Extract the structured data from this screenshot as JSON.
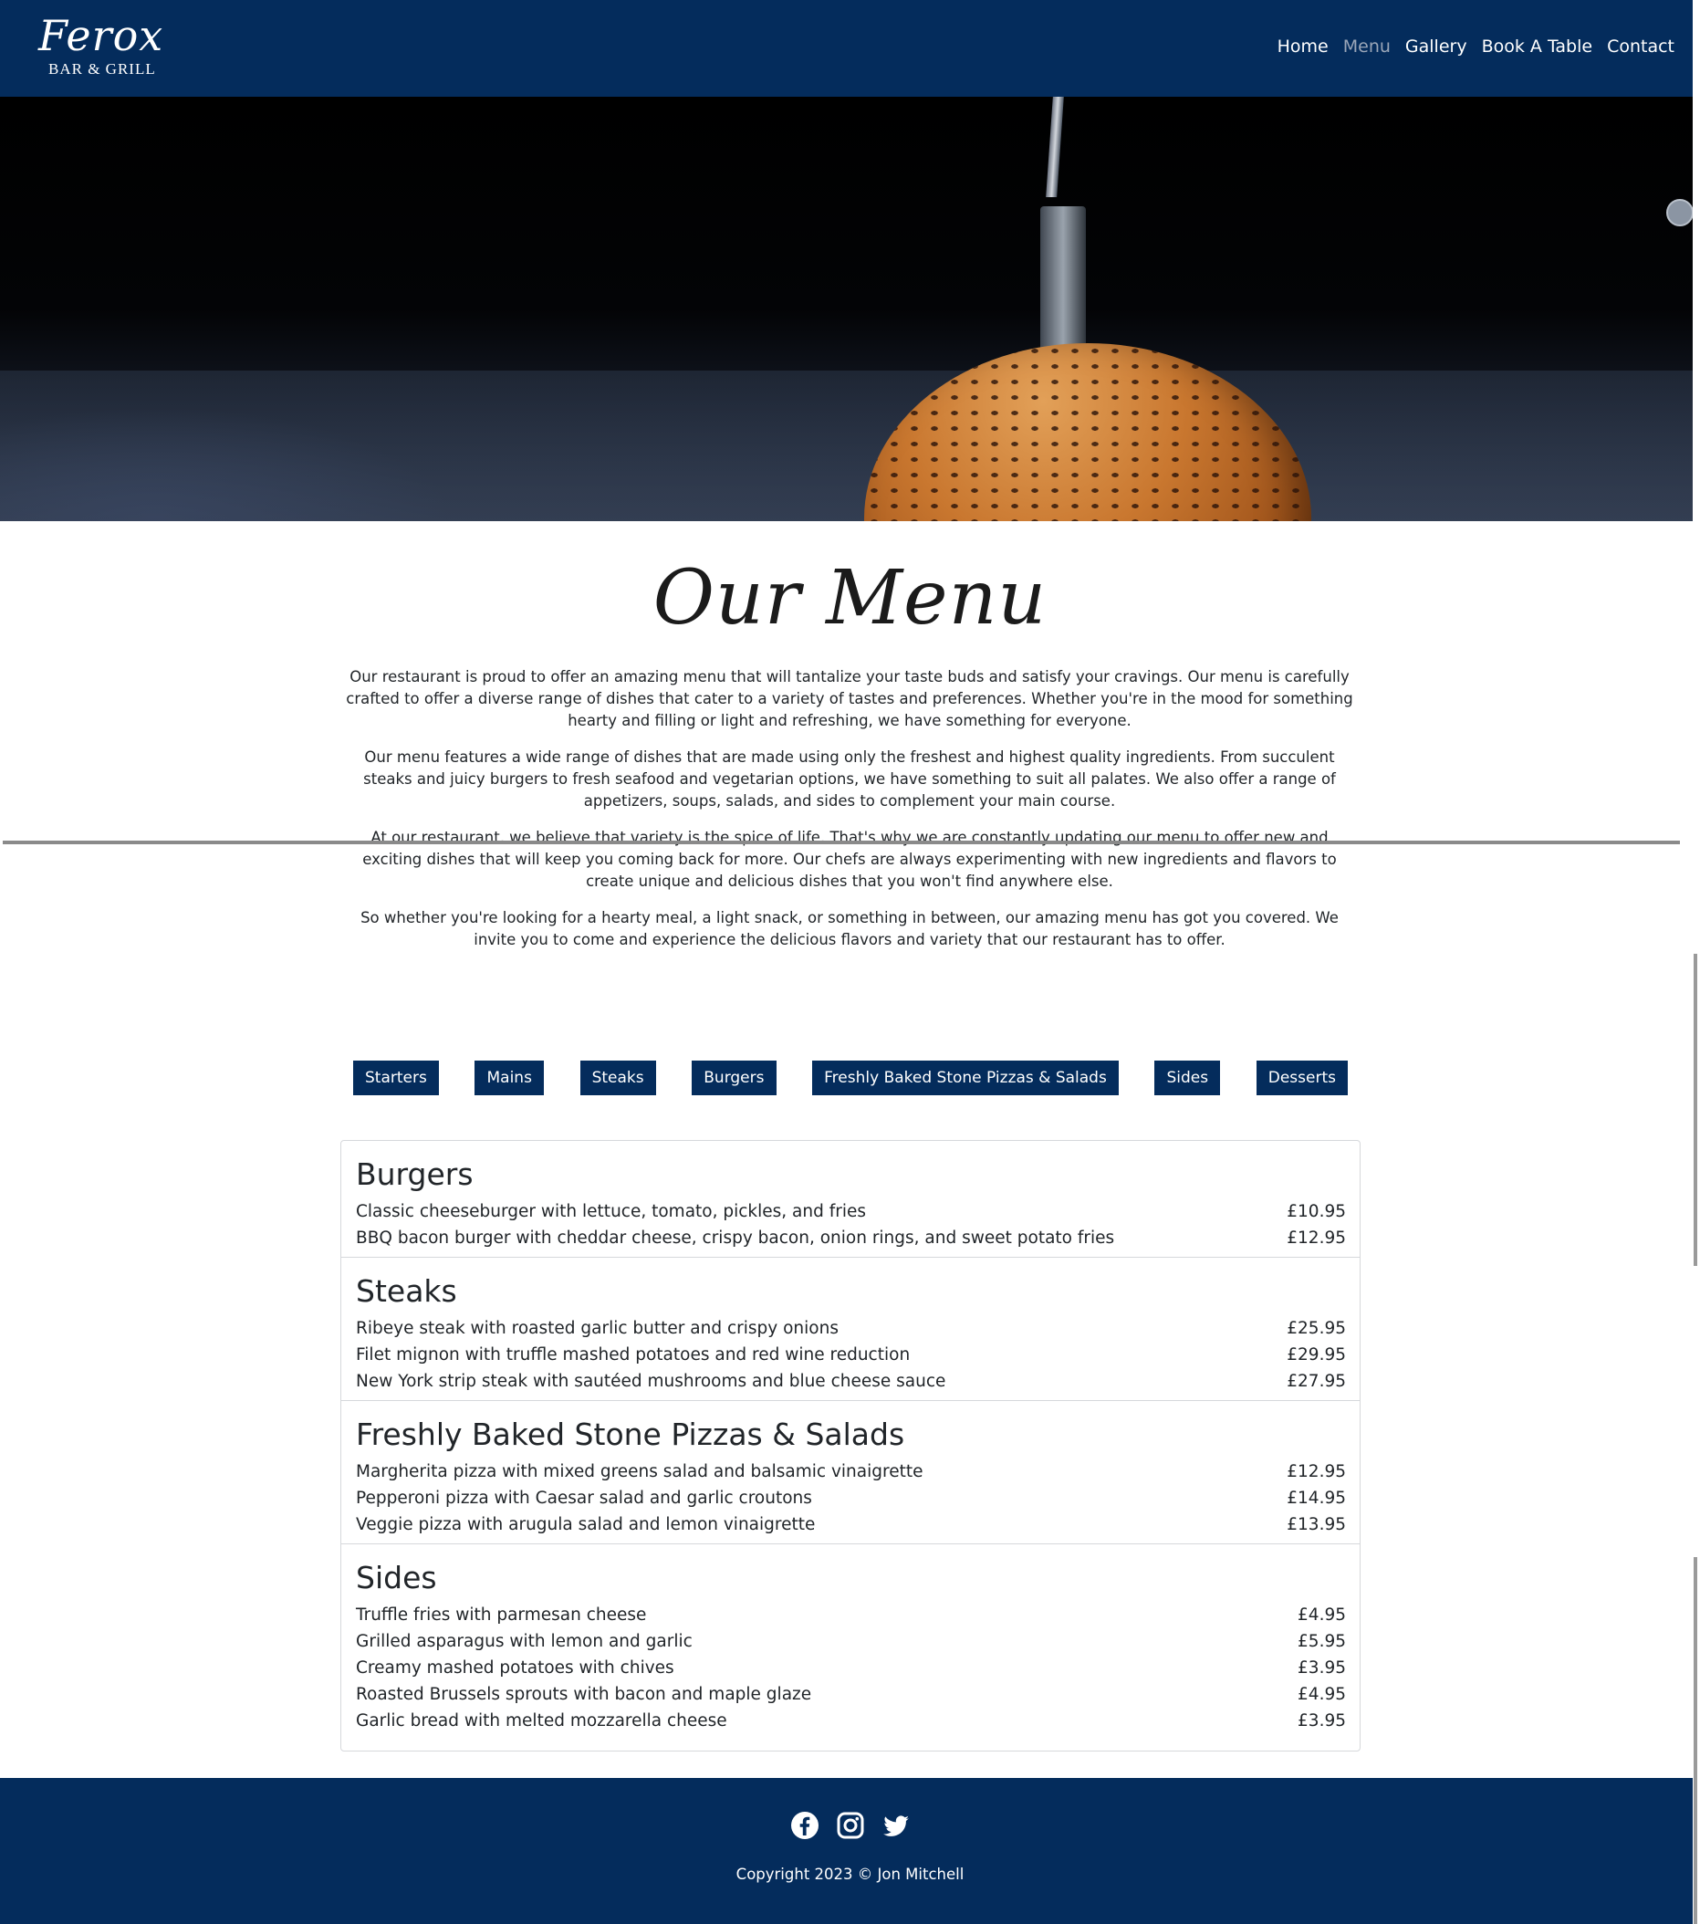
{
  "header": {
    "logo_script": "Ferox",
    "logo_sub": "BAR & GRILL",
    "nav": [
      {
        "label": "Home"
      },
      {
        "label": "Menu"
      },
      {
        "label": "Gallery"
      },
      {
        "label": "Book A Table"
      },
      {
        "label": "Contact"
      }
    ],
    "active_nav": "Menu"
  },
  "hero": {
    "image": "burger bun with knife on dark background"
  },
  "page_title": "Our Menu",
  "intro": [
    "Our restaurant is proud to offer an amazing menu that will tantalize your taste buds and satisfy your cravings. Our menu is carefully crafted to offer a diverse range of dishes that cater to a variety of tastes and preferences. Whether you're in the mood for something hearty and filling or light and refreshing, we have something for everyone.",
    "Our menu features a wide range of dishes that are made using only the freshest and highest quality ingredients. From succulent steaks and juicy burgers to fresh seafood and vegetarian options, we have something to suit all palates. We also offer a range of appetizers, soups, salads, and sides to complement your main course.",
    "At our restaurant, we believe that variety is the spice of life. That's why we are constantly updating our menu to offer new and exciting dishes that will keep you coming back for more. Our chefs are always experimenting with new ingredients and flavors to create unique and delicious dishes that you won't find anywhere else.",
    "So whether you're looking for a hearty meal, a light snack, or something in between, our amazing menu has got you covered. We invite you to come and experience the delicious flavors and variety that our restaurant has to offer."
  ],
  "tabs": [
    {
      "label": "Starters"
    },
    {
      "label": "Mains"
    },
    {
      "label": "Steaks"
    },
    {
      "label": "Burgers"
    },
    {
      "label": "Freshly Baked Stone Pizzas & Salads"
    },
    {
      "label": "Sides"
    },
    {
      "label": "Desserts"
    }
  ],
  "menu": {
    "sections": [
      {
        "title": "Burgers",
        "items": [
          {
            "name": "Classic cheeseburger with lettuce, tomato, pickles, and fries",
            "price": "£10.95"
          },
          {
            "name": "BBQ bacon burger with cheddar cheese, crispy bacon, onion rings, and sweet potato fries",
            "price": "£12.95"
          }
        ]
      },
      {
        "title": "Steaks",
        "items": [
          {
            "name": "Ribeye steak with roasted garlic butter and crispy onions",
            "price": "£25.95"
          },
          {
            "name": "Filet mignon with truffle mashed potatoes and red wine reduction",
            "price": "£29.95"
          },
          {
            "name": "New York strip steak with sautéed mushrooms and blue cheese sauce",
            "price": "£27.95"
          }
        ]
      },
      {
        "title": "Freshly Baked Stone Pizzas & Salads",
        "items": [
          {
            "name": "Margherita pizza with mixed greens salad and balsamic vinaigrette",
            "price": "£12.95"
          },
          {
            "name": "Pepperoni pizza with Caesar salad and garlic croutons",
            "price": "£14.95"
          },
          {
            "name": "Veggie pizza with arugula salad and lemon vinaigrette",
            "price": "£13.95"
          }
        ]
      },
      {
        "title": "Sides",
        "items": [
          {
            "name": "Truffle fries with parmesan cheese",
            "price": "£4.95"
          },
          {
            "name": "Grilled asparagus with lemon and garlic",
            "price": "£5.95"
          },
          {
            "name": "Creamy mashed potatoes with chives",
            "price": "£3.95"
          },
          {
            "name": "Roasted Brussels sprouts with bacon and maple glaze",
            "price": "£4.95"
          },
          {
            "name": "Garlic bread with melted mozzarella cheese",
            "price": "£3.95"
          }
        ]
      }
    ]
  },
  "footer": {
    "socials": [
      "facebook-icon",
      "instagram-icon",
      "twitter-icon"
    ],
    "copyright": "Copyright 2023 © Jon Mitchell"
  },
  "colors": {
    "navy": "#042c5c",
    "nav_active": "#9aa6b8",
    "text": "#212529",
    "border": "#d6d8db"
  }
}
